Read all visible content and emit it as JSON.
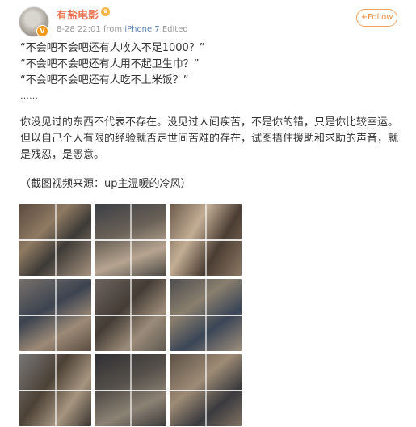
{
  "post": {
    "author": "有盐电影",
    "verified_badge": "v-badge-icon",
    "member_badge": "crown-icon",
    "date": "8-28 22:01",
    "from_label": "from",
    "client": "iPhone 7",
    "edited": "Edited",
    "follow_label": "+Follow",
    "lines": [
      "“不会吧不会吧还有人收入不足1000？”",
      "“不会吧不会吧还有人用不起卫生巾？”",
      "“不会吧不会吧还有人吃不上米饭？”"
    ],
    "ellipsis": "……",
    "paragraph": "你没见过的东西不代表不存在。没见过人间疾苦，不是你的错，只是你比较幸运。但以自己个人有限的经验就否定世间苦难的存在，试图捂住援助和求助的声音，就是残忍，是恶意。",
    "source": "（截图视频来源：up主温暖的冷风）"
  },
  "images": [
    "photo-1",
    "photo-2",
    "photo-3",
    "photo-4",
    "photo-5",
    "photo-6",
    "photo-7",
    "photo-8",
    "photo-9"
  ],
  "colors": {
    "author": "#eb7350",
    "client_link": "#5b82b8",
    "follow_border": "#f4a15c",
    "meta": "#999999"
  }
}
